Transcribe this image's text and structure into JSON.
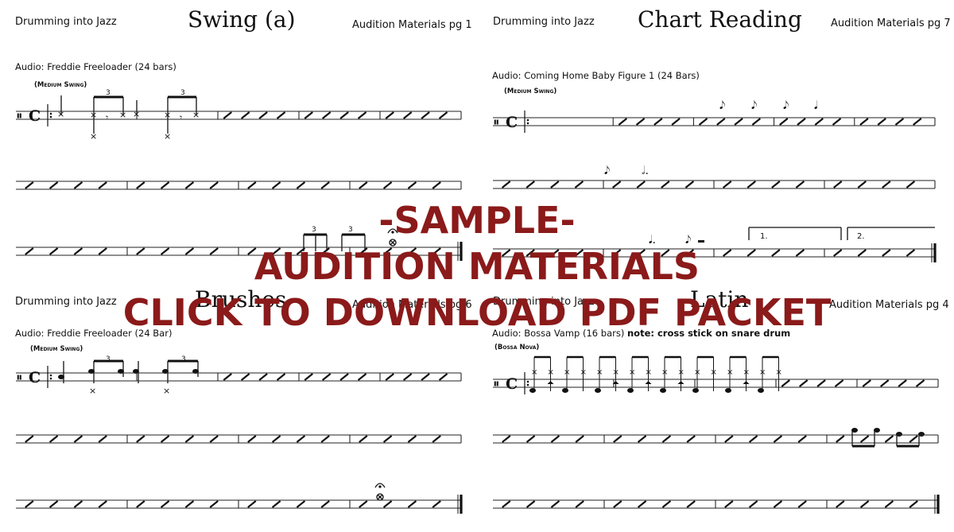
{
  "pages": [
    {
      "book": "Drumming into Jazz",
      "title": "Swing (a)",
      "page_label": "Audition Materials pg 1",
      "audio": "Audio: Freddie Freeloader (24 bars)",
      "tempo": "(Medium Swing)"
    },
    {
      "book": "Drumming into Jazz",
      "title": "Chart Reading",
      "page_label": "Audition Materials pg 7",
      "audio": "Audio: Coming Home Baby Figure 1 (24 Bars)",
      "tempo": "(Medium Swing)",
      "endings": [
        "1.",
        "2."
      ]
    },
    {
      "book": "Drumming into Jazz",
      "title": "Brushes",
      "page_label": "Audition Materials pg 6",
      "audio": "Audio: Freddie Freeloader (24 Bar)",
      "tempo": "(Medium Swing)"
    },
    {
      "book": "Drumming into Jazz",
      "title": "Latin",
      "page_label": "Audition Materials pg 4",
      "audio": "Audio: Bossa Vamp (16 bars)",
      "audio_note": "note: cross stick on snare drum",
      "tempo": "(Bossa Nova)"
    }
  ],
  "watermark": {
    "line1": "-SAMPLE-",
    "line2": "AUDITION MATERIALS",
    "line3": "CLICK TO DOWNLOAD PDF PACKET",
    "color": "#8b1a1a"
  },
  "notation": {
    "time_signature": "C",
    "tuplet_label": "3",
    "bars_per_system": 4
  }
}
